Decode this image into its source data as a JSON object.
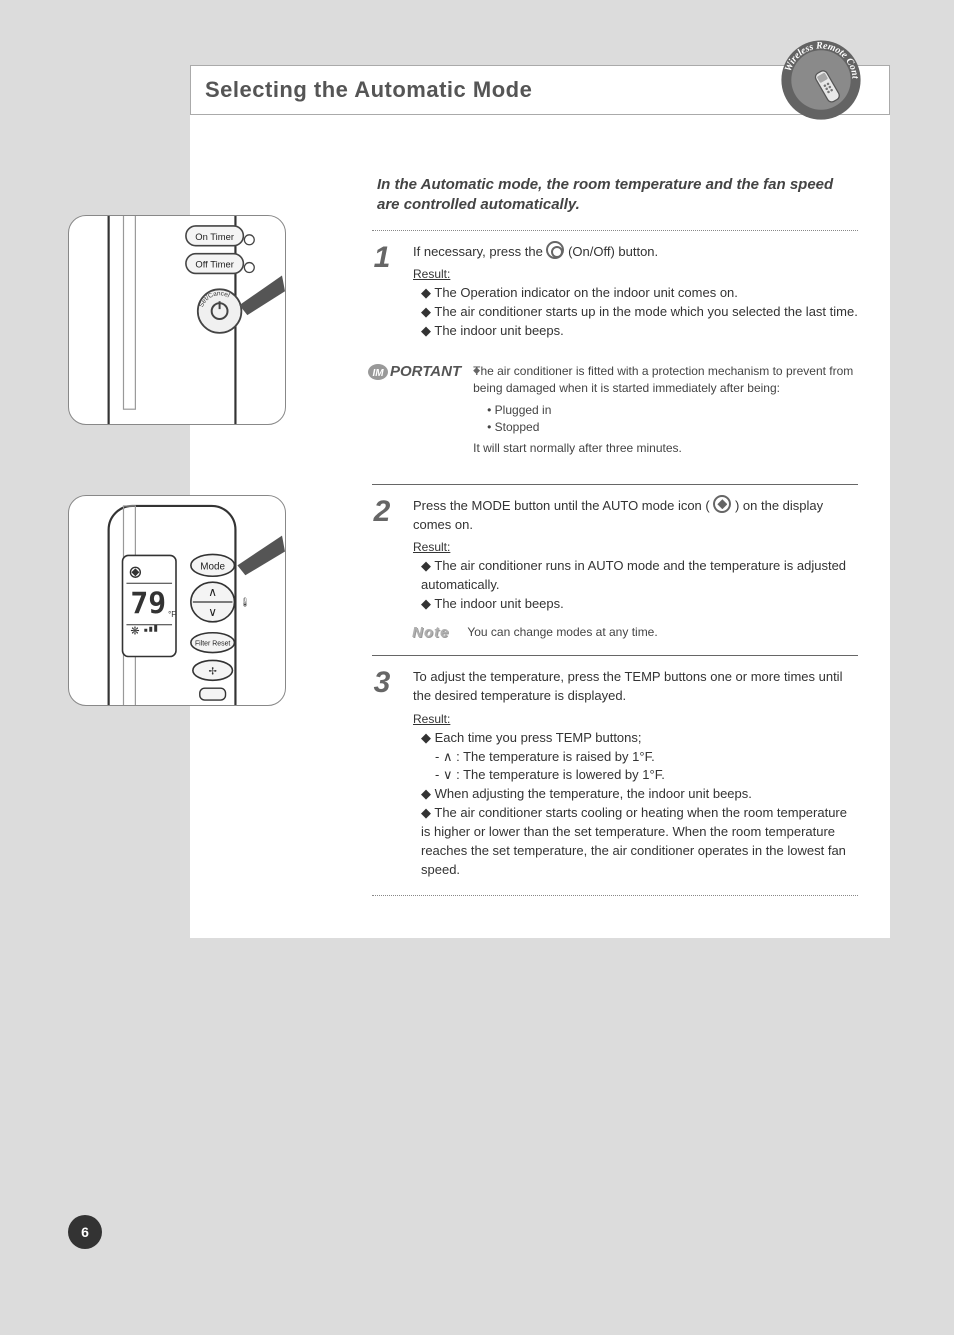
{
  "title": "Selecting the Automatic Mode",
  "badge_label": "Wireless Remote Controller",
  "intro": "In the Automatic mode, the room temperature and the fan speed are controlled automatically.",
  "steps": [
    {
      "num": "1",
      "text_a": "If necessary, press the ",
      "text_b": " (On/Off) button.",
      "result_label": "Result:",
      "result_bullet": "The Operation indicator on the indoor unit comes on.",
      "result_bullet2": "The air conditioner starts up in the mode which you selected the last time.",
      "result_bullet3": "The indoor unit beeps."
    }
  ],
  "important_label": "PORTANT",
  "important": [
    "The air conditioner is fitted with a protection mechanism to prevent from being damaged when it is started immediately after being:",
    "Plugged in",
    "Stopped",
    "It will start normally after three minutes."
  ],
  "step2": {
    "num": "2",
    "text_a": "Press the MODE button until the AUTO mode icon (",
    "text_b": ") on the display comes on.",
    "result_label": "Result:",
    "result_bullet": "The air conditioner runs in AUTO mode and the temperature is adjusted automatically.",
    "result_bullet2": "The indoor unit beeps."
  },
  "note_label": "Note",
  "note_body": "You can change modes at any time.",
  "step3": {
    "num": "3",
    "text": "To adjust the temperature, press the TEMP buttons one or more times until the desired temperature is displayed.",
    "result_label": "Result:",
    "result_bullet": "Each time you press TEMP buttons;",
    "result_sub_a": ": The temperature is raised by 1°F.",
    "result_sub_b": ": The temperature is lowered by 1°F.",
    "result_bullet2": "When adjusting the temperature, the indoor unit beeps.",
    "result_bullet3": "The air conditioner starts cooling or heating when the room temperature is higher or lower than the set temperature. When the room temperature reaches the set temperature, the air conditioner operates in the lowest fan speed."
  },
  "remote_display": {
    "temp": "79",
    "unit": "°F",
    "mode_label": "Mode",
    "filter_label": "Filter Reset",
    "on_timer": "On Timer",
    "off_timer": "Off Timer"
  },
  "page_number": "6"
}
